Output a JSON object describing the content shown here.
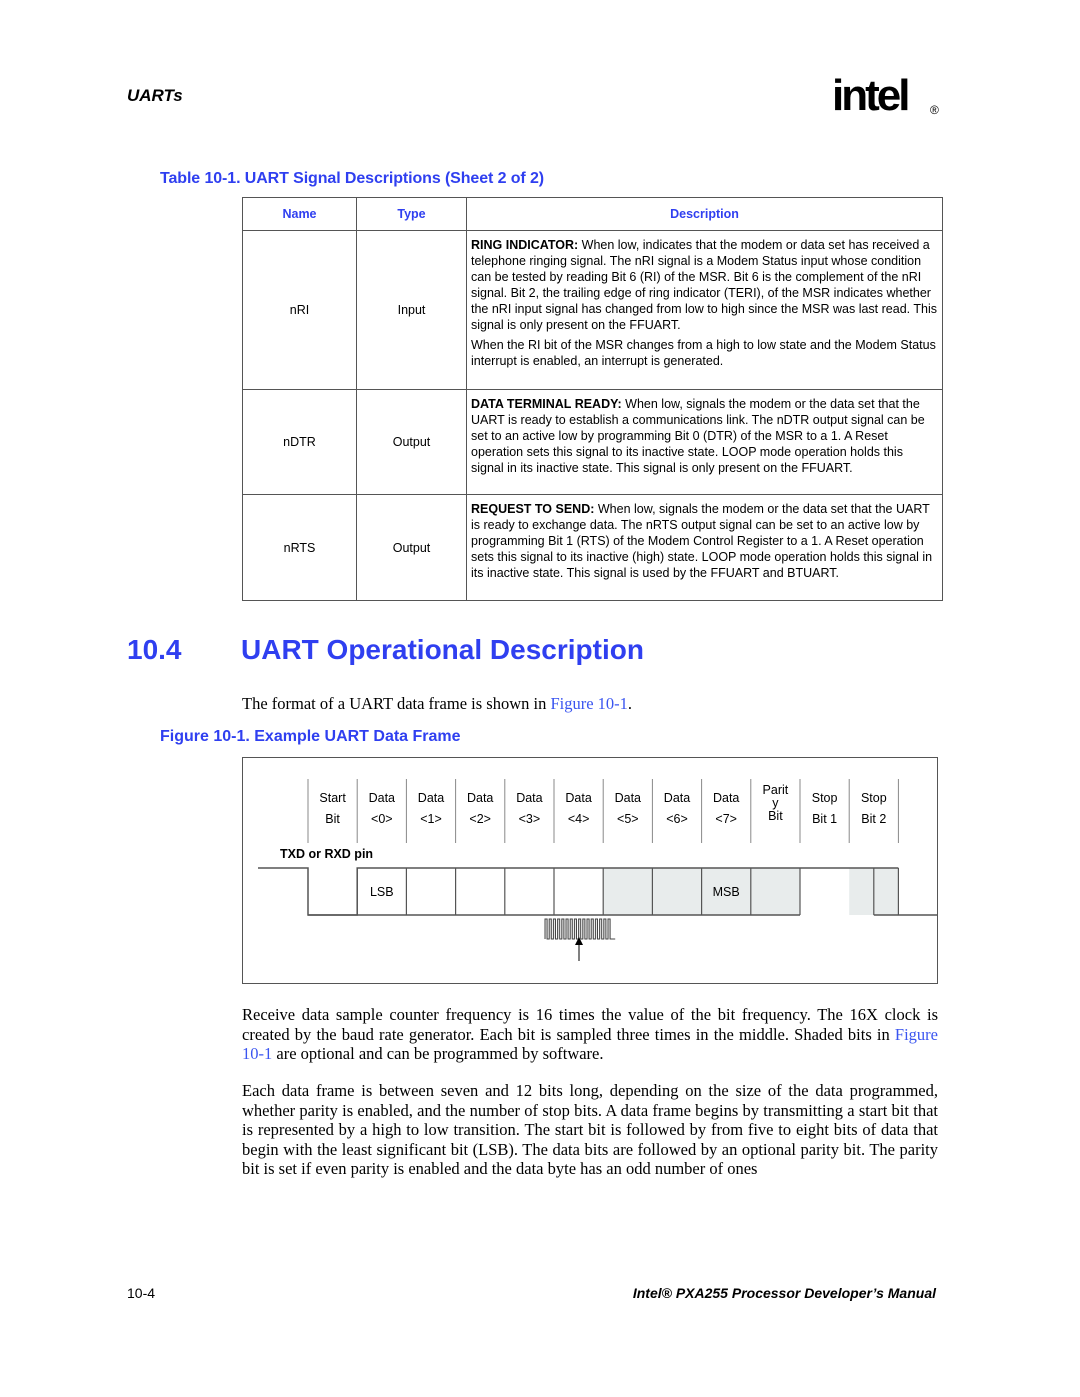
{
  "header": {
    "chapter": "UARTs",
    "logo_text": "intel",
    "logo_mark": "®"
  },
  "table": {
    "caption": "Table 10-1. UART Signal Descriptions (Sheet 2 of 2)",
    "columns": [
      "Name",
      "Type",
      "Description"
    ],
    "rows": [
      {
        "name": "nRI",
        "type": "Input",
        "desc_bold": "RING INDICATOR:",
        "desc": " When low, indicates that the modem or data set has received a telephone ringing signal. The nRI signal is a Modem Status input whose condition can be tested by reading Bit 6 (RI) of the MSR. Bit 6 is the complement of the nRI signal. Bit 2, the trailing edge of ring indicator (TERI), of the MSR indicates whether the nRI input signal has changed from low to high since the MSR was last read. This signal is only present on the FFUART.",
        "desc_extra": "When the RI bit of the MSR changes from a high to low state and the Modem Status interrupt is enabled, an interrupt is generated."
      },
      {
        "name": "nDTR",
        "type": "Output",
        "desc_bold": "DATA TERMINAL READY:",
        "desc": " When low, signals the modem or the data set that the UART is ready to establish a communications link. The nDTR output signal can be set to an active low by programming Bit 0 (DTR) of the MSR to a 1. A Reset operation sets this signal to its inactive state. LOOP mode operation holds this signal in its inactive state. This signal is only present on the FFUART."
      },
      {
        "name": "nRTS",
        "type": "Output",
        "desc_bold": "REQUEST TO SEND:",
        "desc": " When low, signals the modem or the data set that the UART is ready to exchange data. The nRTS output signal can be set to an active low by programming Bit 1 (RTS) of the Modem Control Register to a 1. A Reset operation sets this signal to its inactive (high) state. LOOP mode operation holds this signal in its inactive state. This signal is used by the FFUART and BTUART."
      }
    ]
  },
  "section": {
    "number": "10.4",
    "title": "UART Operational Description",
    "intro_text": "The format of a UART data frame is shown in ",
    "intro_link": "Figure 10-1",
    "intro_end": "."
  },
  "figure": {
    "caption": "Figure 10-1. Example UART Data Frame",
    "pin_label": "TXD or RXD pin",
    "bits": [
      {
        "lines": [
          "Start",
          "Bit"
        ],
        "shaded": false,
        "inner": ""
      },
      {
        "lines": [
          "Data",
          "<0>"
        ],
        "shaded": false,
        "inner": "LSB"
      },
      {
        "lines": [
          "Data",
          "<1>"
        ],
        "shaded": false,
        "inner": ""
      },
      {
        "lines": [
          "Data",
          "<2>"
        ],
        "shaded": false,
        "inner": ""
      },
      {
        "lines": [
          "Data",
          "<3>"
        ],
        "shaded": false,
        "inner": ""
      },
      {
        "lines": [
          "Data",
          "<4>"
        ],
        "shaded": false,
        "inner": ""
      },
      {
        "lines": [
          "Data",
          "<5>"
        ],
        "shaded": true,
        "inner": ""
      },
      {
        "lines": [
          "Data",
          "<6>"
        ],
        "shaded": true,
        "inner": ""
      },
      {
        "lines": [
          "Data",
          "<7>"
        ],
        "shaded": true,
        "inner": "MSB"
      },
      {
        "lines": [
          "Parit",
          "y",
          "Bit"
        ],
        "shaded": true,
        "inner": ""
      },
      {
        "lines": [
          "Stop",
          "Bit 1"
        ],
        "shaded": false,
        "inner": ""
      },
      {
        "lines": [
          "Stop",
          "Bit 2"
        ],
        "shaded": true,
        "inner": ""
      }
    ],
    "sample_clock_multiplier": 16,
    "colors": {
      "shade": "#e8ecec",
      "line": "#555555"
    }
  },
  "body": {
    "para1_before": "Receive data sample counter frequency is 16 times the value of the bit frequency. The 16X clock is created by the baud rate generator. Each bit is sampled three times in the middle. Shaded bits in ",
    "para1_link": "Figure 10-1",
    "para1_after": " are optional and can be programmed by software.",
    "para2": "Each data frame is between seven and 12 bits long, depending on the size of the data programmed, whether parity is enabled, and the number of stop bits. A data frame begins by transmitting a start bit that is represented by a high to low transition. The start bit is followed by from five to eight bits of data that begin with the least significant bit (LSB). The data bits are followed by an optional parity bit. The parity bit is set if even parity is enabled and the data byte has an odd number of ones"
  },
  "footer": {
    "page_number": "10-4",
    "manual_title": "Intel® PXA255 Processor Developer’s Manual"
  },
  "theme": {
    "heading_blue": "#2f3ff0",
    "link_blue": "#3a55f0"
  }
}
